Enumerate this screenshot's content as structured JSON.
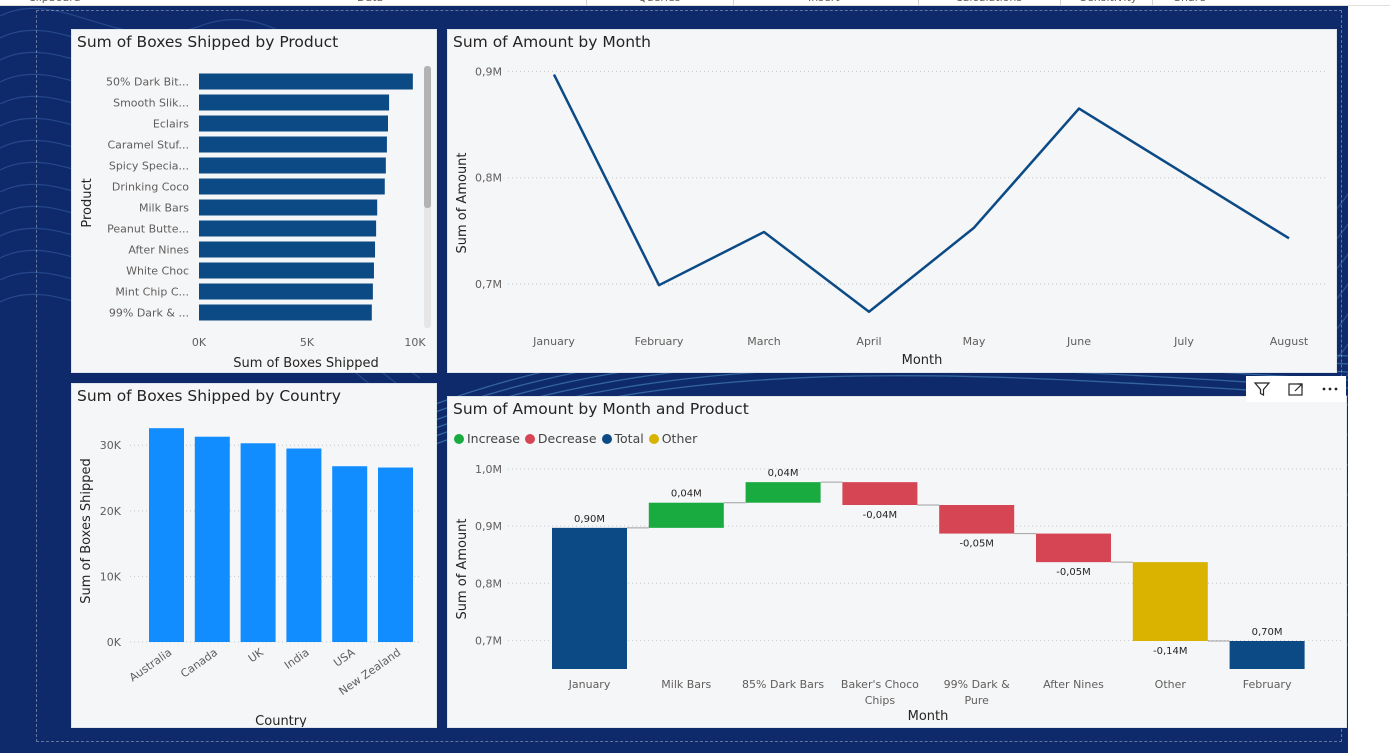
{
  "ribbon": {
    "groups": [
      "Clipboard",
      "Data",
      "Queries",
      "Insert",
      "Calculations",
      "Sensitivity",
      "Share"
    ]
  },
  "colors": {
    "background": "#0f2a6b",
    "bar_product": "#0b4a85",
    "bar_country": "#118dff",
    "line": "#0b4a85",
    "increase": "#1aab40",
    "decrease": "#d64554",
    "total": "#0b4a85",
    "other": "#d9b300"
  },
  "visuals": {
    "product": {
      "title": "Sum of Boxes Shipped by Product",
      "xlabel": "Sum of Boxes Shipped",
      "ylabel": "Product"
    },
    "month": {
      "title": "Sum of Amount by Month",
      "xlabel": "Month",
      "ylabel": "Sum of Amount"
    },
    "country": {
      "title": "Sum of Boxes Shipped by Country",
      "xlabel": "Country",
      "ylabel": "Sum of Boxes Shipped"
    },
    "waterfall": {
      "title": "Sum of Amount by Month and Product",
      "xlabel": "Month",
      "ylabel": "Sum of Amount",
      "legend": [
        {
          "label": "Increase",
          "color": "#1aab40"
        },
        {
          "label": "Decrease",
          "color": "#d64554"
        },
        {
          "label": "Total",
          "color": "#0b4a85"
        },
        {
          "label": "Other",
          "color": "#d9b300"
        }
      ],
      "header_icons": [
        "filter-icon",
        "focus-mode-icon",
        "more-options-icon"
      ]
    }
  },
  "chart_data": [
    {
      "type": "bar",
      "orientation": "horizontal",
      "title": "Sum of Boxes Shipped by Product",
      "xlabel": "Sum of Boxes Shipped",
      "ylabel": "Product",
      "categories": [
        "50% Dark Bit...",
        "Smooth Slik...",
        "Eclairs",
        "Caramel Stuf...",
        "Spicy Specia...",
        "Drinking Coco",
        "Milk Bars",
        "Peanut Butte...",
        "After Nines",
        "White Choc",
        "Mint Chip C...",
        "99% Dark & ..."
      ],
      "values": [
        9900,
        8800,
        8750,
        8700,
        8650,
        8600,
        8250,
        8200,
        8150,
        8100,
        8050,
        8000
      ],
      "xlim": [
        0,
        10000
      ],
      "ticks": [
        0,
        5000,
        10000
      ],
      "tick_labels": [
        "0K",
        "5K",
        "10K"
      ]
    },
    {
      "type": "line",
      "title": "Sum of Amount by Month",
      "xlabel": "Month",
      "ylabel": "Sum of Amount",
      "x": [
        "January",
        "February",
        "March",
        "April",
        "May",
        "June",
        "July",
        "August"
      ],
      "values": [
        0.897,
        0.699,
        0.749,
        0.674,
        0.753,
        0.865,
        0.804,
        0.743
      ],
      "units": "M",
      "ylim": [
        0.655,
        0.905
      ],
      "ticks": [
        0.7,
        0.8,
        0.9
      ],
      "tick_labels": [
        "0,7M",
        "0,8M",
        "0,9M"
      ],
      "grid": true
    },
    {
      "type": "bar",
      "title": "Sum of Boxes Shipped by Country",
      "xlabel": "Country",
      "ylabel": "Sum of Boxes Shipped",
      "categories": [
        "Australia",
        "Canada",
        "UK",
        "India",
        "USA",
        "New Zealand"
      ],
      "values": [
        32600,
        31300,
        30300,
        29500,
        26800,
        26600
      ],
      "ylim": [
        0,
        34000
      ],
      "ticks": [
        0,
        10000,
        20000,
        30000
      ],
      "tick_labels": [
        "0K",
        "10K",
        "20K",
        "30K"
      ],
      "grid": true
    },
    {
      "type": "waterfall",
      "title": "Sum of Amount by Month and Product",
      "xlabel": "Month",
      "ylabel": "Sum of Amount",
      "categories": [
        "January",
        "Milk Bars",
        "85% Dark Bars",
        "Baker's Choco Chips",
        "99% Dark & Pure",
        "After Nines",
        "Other",
        "February"
      ],
      "kinds": [
        "total",
        "increase",
        "increase",
        "decrease",
        "decrease",
        "decrease",
        "other",
        "total"
      ],
      "values": [
        0.897,
        0.044,
        0.036,
        -0.04,
        -0.05,
        -0.05,
        -0.138,
        0.699
      ],
      "labels": [
        "0,90M",
        "0,04M",
        "0,04M",
        "-0,04M",
        "-0,05M",
        "-0,05M",
        "-0,14M",
        "0,70M"
      ],
      "units": "M",
      "ylim": [
        0.65,
        1.0
      ],
      "ticks": [
        0.7,
        0.8,
        0.9,
        1.0
      ],
      "tick_labels": [
        "0,7M",
        "0,8M",
        "0,9M",
        "1,0M"
      ],
      "legend_position": "top-left",
      "grid": true
    }
  ]
}
